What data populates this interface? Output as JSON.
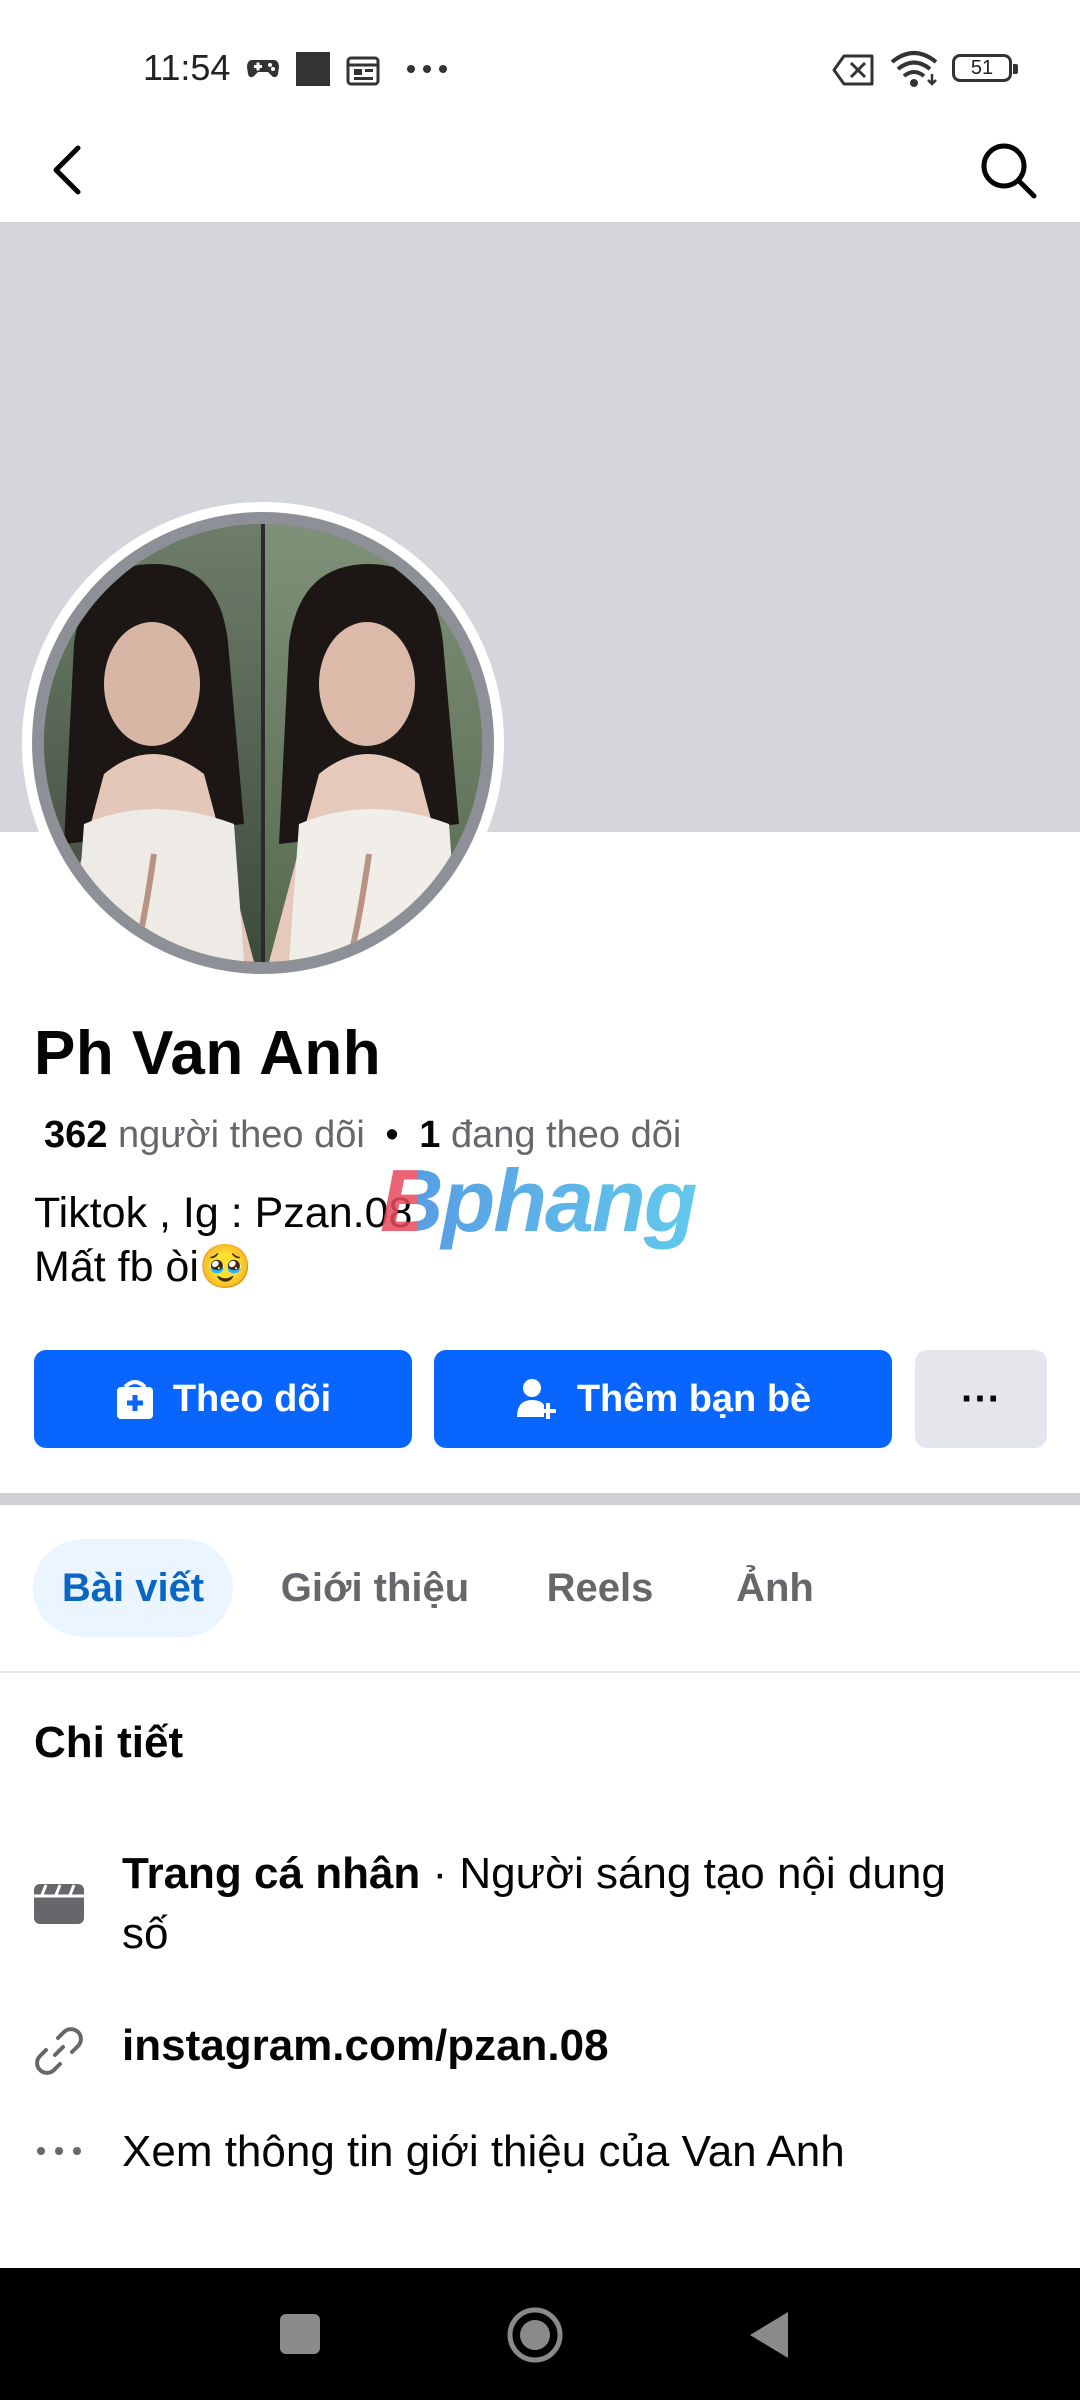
{
  "status_bar": {
    "time": "11:54",
    "battery": "51"
  },
  "profile": {
    "name": "Ph Van Anh",
    "followers_count": "362",
    "followers_label": "người theo dõi",
    "separator": "•",
    "following_count": "1",
    "following_label": "đang theo dõi",
    "bio_line1": "Tiktok , Ig : Pzan.08",
    "bio_line2": "Mất fb òi🥹"
  },
  "watermark": "Bphang",
  "actions": {
    "follow_label": "Theo dõi",
    "add_friend_label": "Thêm bạn bè",
    "more_label": "···"
  },
  "tabs": [
    {
      "label": "Bài viết",
      "active": true
    },
    {
      "label": "Giới thiệu",
      "active": false
    },
    {
      "label": "Reels",
      "active": false
    },
    {
      "label": "Ảnh",
      "active": false
    }
  ],
  "details": {
    "title": "Chi tiết",
    "page_type_bold": "Trang cá nhân",
    "page_type_rest": " · Người sáng tạo nội dung số",
    "link": "instagram.com/pzan.08",
    "see_more": "Xem thông tin giới thiệu của Van Anh"
  },
  "icons": {
    "back": "back-arrow-icon",
    "search": "search-icon",
    "follow": "follow-icon",
    "add_friend": "add-friend-icon",
    "page": "clapperboard-icon",
    "link": "link-icon",
    "more": "more-dots-icon"
  },
  "colors": {
    "primary": "#0866ff",
    "active_tab_bg": "#ebf5ff",
    "active_tab_text": "#0a66c2",
    "cover": "#d4d6db"
  }
}
